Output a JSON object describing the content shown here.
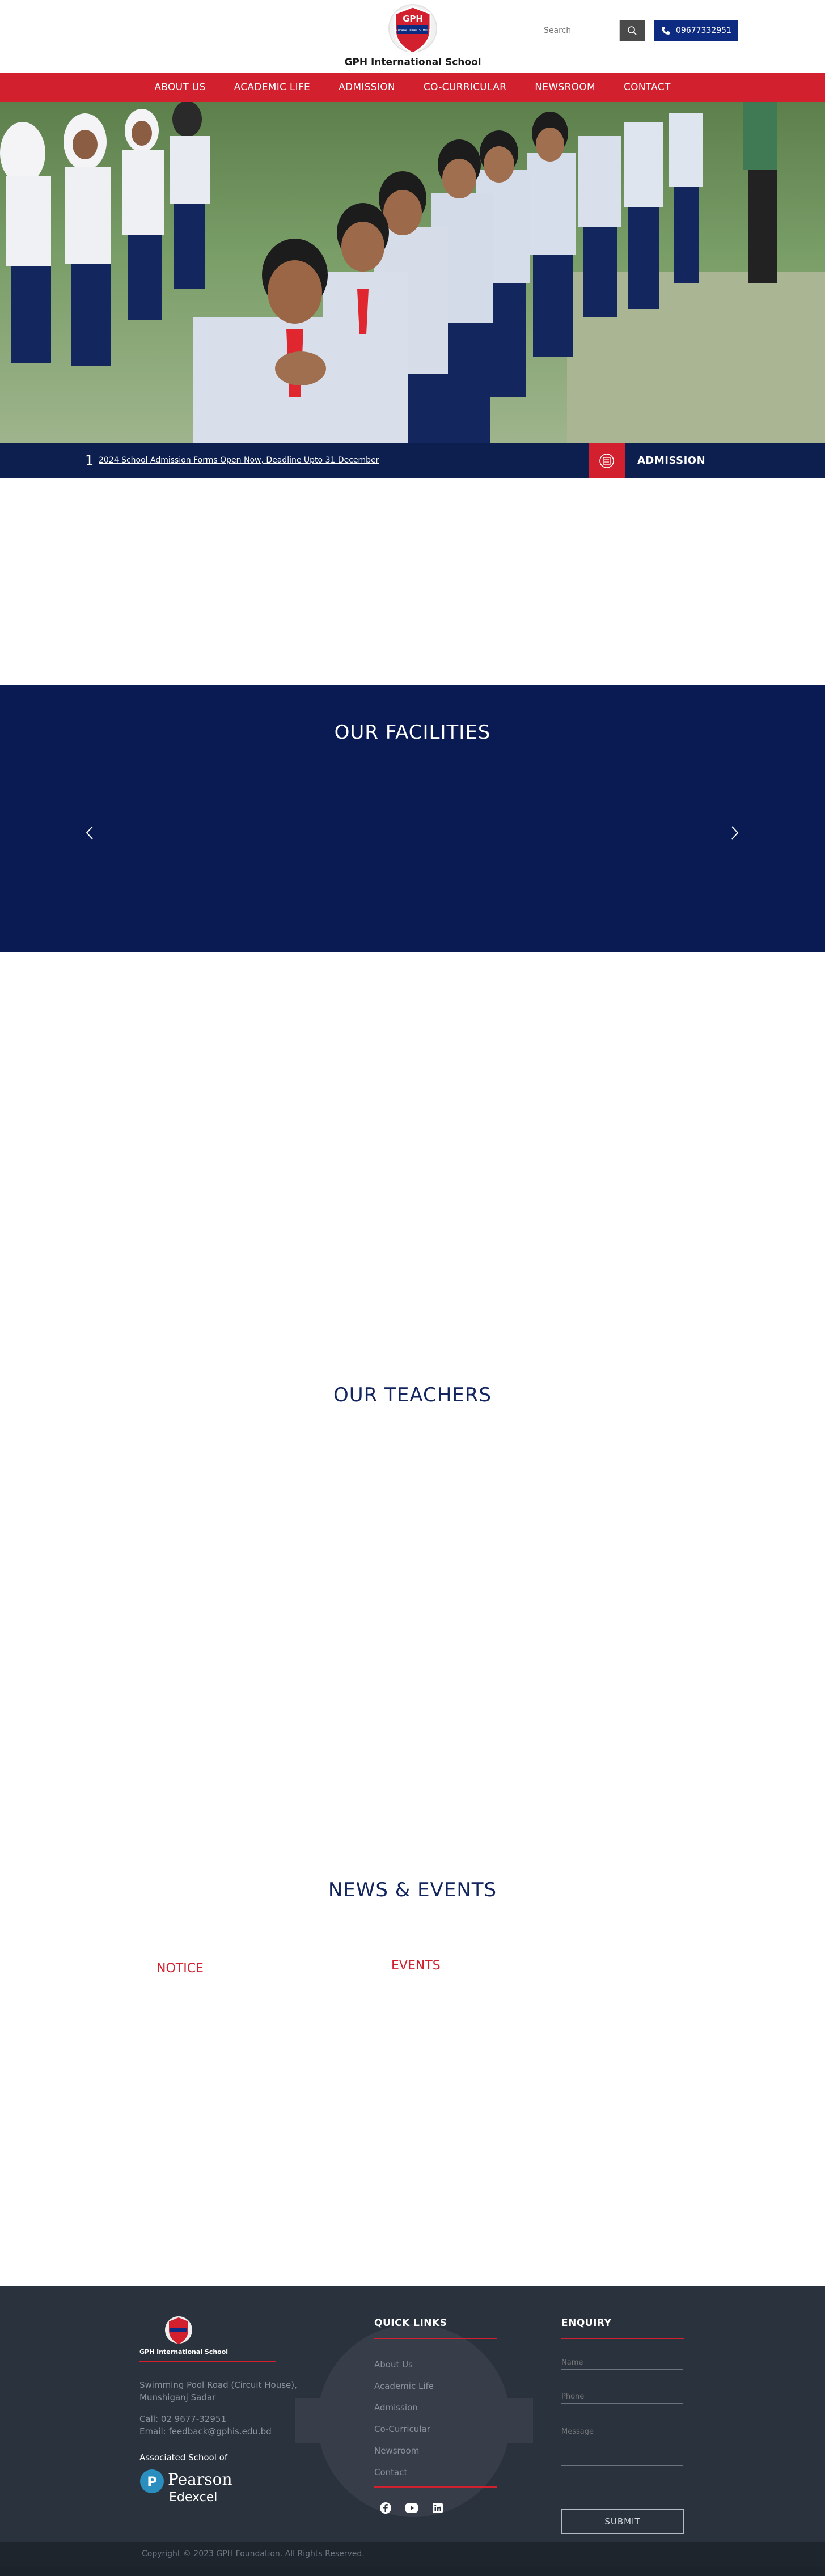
{
  "header": {
    "logo_badge_text": "GPH",
    "logo_badge_sub": "INTERNATIONAL SCHOOL",
    "school_name": "GPH International School",
    "search_placeholder": "Search",
    "phone": "09677332951"
  },
  "nav": {
    "items": [
      "ABOUT US",
      "ACADEMIC LIFE",
      "ADMISSION",
      "CO-CURRICULAR",
      "NEWSROOM",
      "CONTACT"
    ]
  },
  "ticker": {
    "number": "1",
    "text": "2024 School Admission Forms Open Now, Deadline Upto 31 December",
    "admission_label": "ADMISSION"
  },
  "sections": {
    "facilities_title": "OUR FACILITIES",
    "teachers_title": "OUR TEACHERS",
    "news_title": "NEWS & EVENTS",
    "notice_tab": "NOTICE",
    "events_tab": "EVENTS"
  },
  "footer": {
    "school_name": "GPH International School",
    "address_line1": "Swimming Pool Road (Circuit House),",
    "address_line2": "Munshiganj Sadar",
    "call": "Call: 02 9677-32951",
    "email": "Email: feedback@gphis.edu.bd",
    "associated_label": "Associated School of",
    "pearson": "Pearson",
    "edexcel": "Edexcel",
    "quick_links_title": "QUICK LINKS",
    "quick_links": [
      "About Us",
      "Academic Life",
      "Admission",
      "Co-Curricular",
      "Newsroom",
      "Contact"
    ],
    "enquiry_title": "ENQUIRY",
    "name_placeholder": "Name",
    "phone_placeholder": "Phone",
    "message_placeholder": "Message",
    "submit_label": "SUBMIT",
    "copyright": "Copyright © 2023 GPH Foundation. All Rights Reserved."
  },
  "colors": {
    "brand_red": "#d2202f",
    "brand_navy": "#0a1a52",
    "footer_bg": "#2a323e"
  },
  "icons": [
    "search-icon",
    "phone-icon",
    "admission-icon",
    "chevron-left-icon",
    "chevron-right-icon",
    "facebook-icon",
    "youtube-icon",
    "linkedin-icon"
  ]
}
